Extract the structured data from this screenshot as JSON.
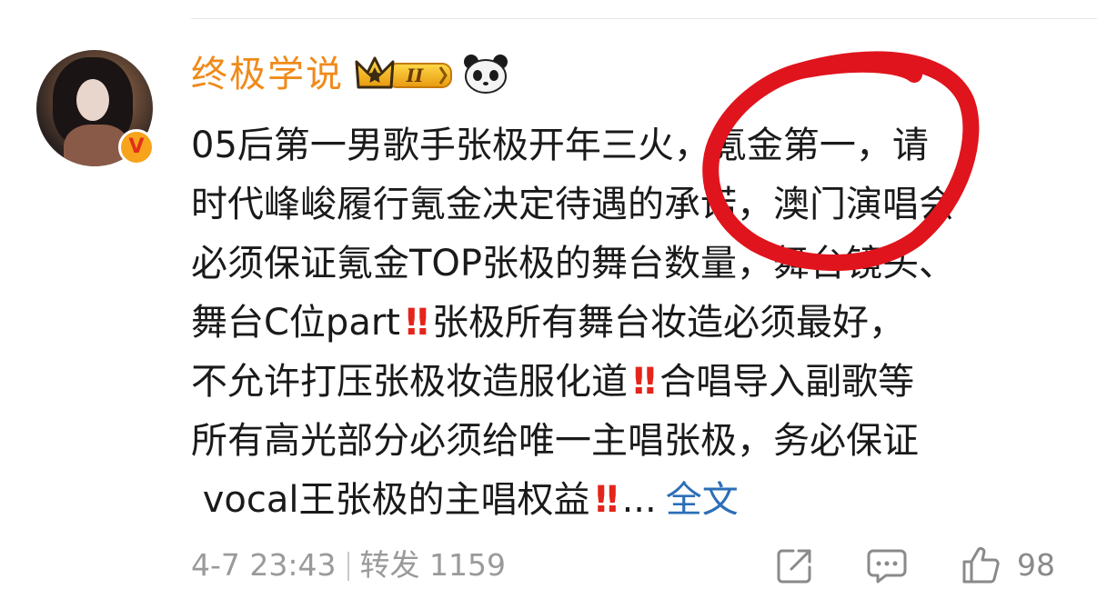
{
  "post": {
    "username": "终极学说",
    "level_badge": "II",
    "lines": [
      "05后第一男歌手张极开年三火，氪金第一，请",
      "时代峰峻履行氪金决定待遇的承诺，澳门演唱会",
      "必须保证氪金TOP张极的舞台数量，舞台镜头、",
      "舞台C位part",
      "张极所有舞台妆造必须最好，",
      "不允许打压张极妆造服化道",
      "合唱导入副歌等",
      "所有高光部分必须给唯一主唱张极，务必保证",
      "vocal王张极的主唱权益",
      "..."
    ],
    "emphasis": "‼",
    "more_label": "全文",
    "timestamp": "4-7 23:43",
    "repost_label": "转发 1159",
    "like_count": "98"
  },
  "icons": [
    "crown-badge-icon",
    "panda-icon",
    "verified-v-icon",
    "share-icon",
    "comment-icon",
    "like-icon"
  ],
  "colors": {
    "username": "#f08a1a",
    "link": "#2c6fb7",
    "emphasis": "#e4251c",
    "annotation": "#e0141c",
    "meta": "#9a9a9a"
  }
}
